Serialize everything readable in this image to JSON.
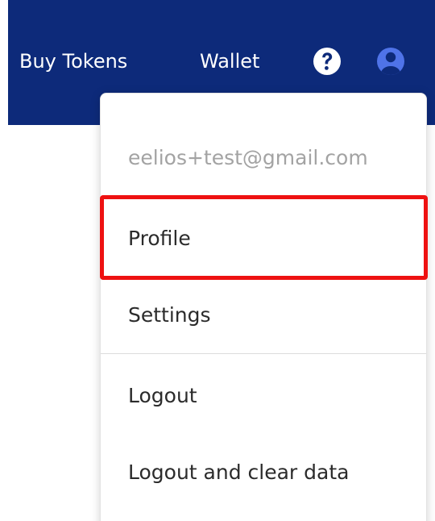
{
  "colors": {
    "navbar_bg": "#0d2a7a",
    "nav_text": "#ffffff",
    "user_icon": "#4f73e8",
    "email_text": "#a3a3a3",
    "menu_text": "#2b2b2b",
    "highlight": "#ee1111"
  },
  "navbar": {
    "links": [
      {
        "label": "Buy Tokens"
      },
      {
        "label": "Wallet"
      }
    ],
    "icons": {
      "help": "help-circle-icon",
      "user": "user-circle-icon"
    }
  },
  "dropdown": {
    "email": "eelios+test@gmail.com",
    "items": [
      {
        "label": "Profile",
        "highlighted": true
      },
      {
        "label": "Settings"
      },
      {
        "label": "Logout"
      },
      {
        "label": "Logout and clear data"
      }
    ]
  }
}
